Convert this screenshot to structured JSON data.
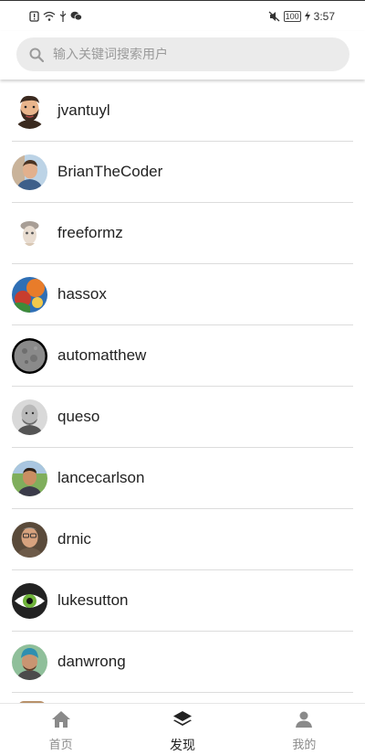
{
  "status_bar": {
    "battery": "100",
    "time": "3:57"
  },
  "search": {
    "placeholder": "输入关键词搜索用户",
    "value": ""
  },
  "users": [
    {
      "name": "jvantuyl",
      "avatar": "avatar-cartoon-bearded-man"
    },
    {
      "name": "BrianTheCoder",
      "avatar": "avatar-photo"
    },
    {
      "name": "freeformz",
      "avatar": "avatar-illustration"
    },
    {
      "name": "hassox",
      "avatar": "avatar-photo"
    },
    {
      "name": "automatthew",
      "avatar": "avatar-moon"
    },
    {
      "name": "queso",
      "avatar": "avatar-photo"
    },
    {
      "name": "lancecarlson",
      "avatar": "avatar-photo"
    },
    {
      "name": "drnic",
      "avatar": "avatar-photo"
    },
    {
      "name": "lukesutton",
      "avatar": "avatar-eye"
    },
    {
      "name": "danwrong",
      "avatar": "avatar-photo"
    }
  ],
  "tabs": [
    {
      "label": "首页",
      "icon": "home-icon",
      "active": false
    },
    {
      "label": "发现",
      "icon": "layers-icon",
      "active": true
    },
    {
      "label": "我的",
      "icon": "person-icon",
      "active": false
    }
  ],
  "colors": {
    "active_tab": "#222222",
    "inactive_tab": "#8a8a8a",
    "search_bg": "#ebebeb",
    "divider": "#dcdcdc"
  }
}
